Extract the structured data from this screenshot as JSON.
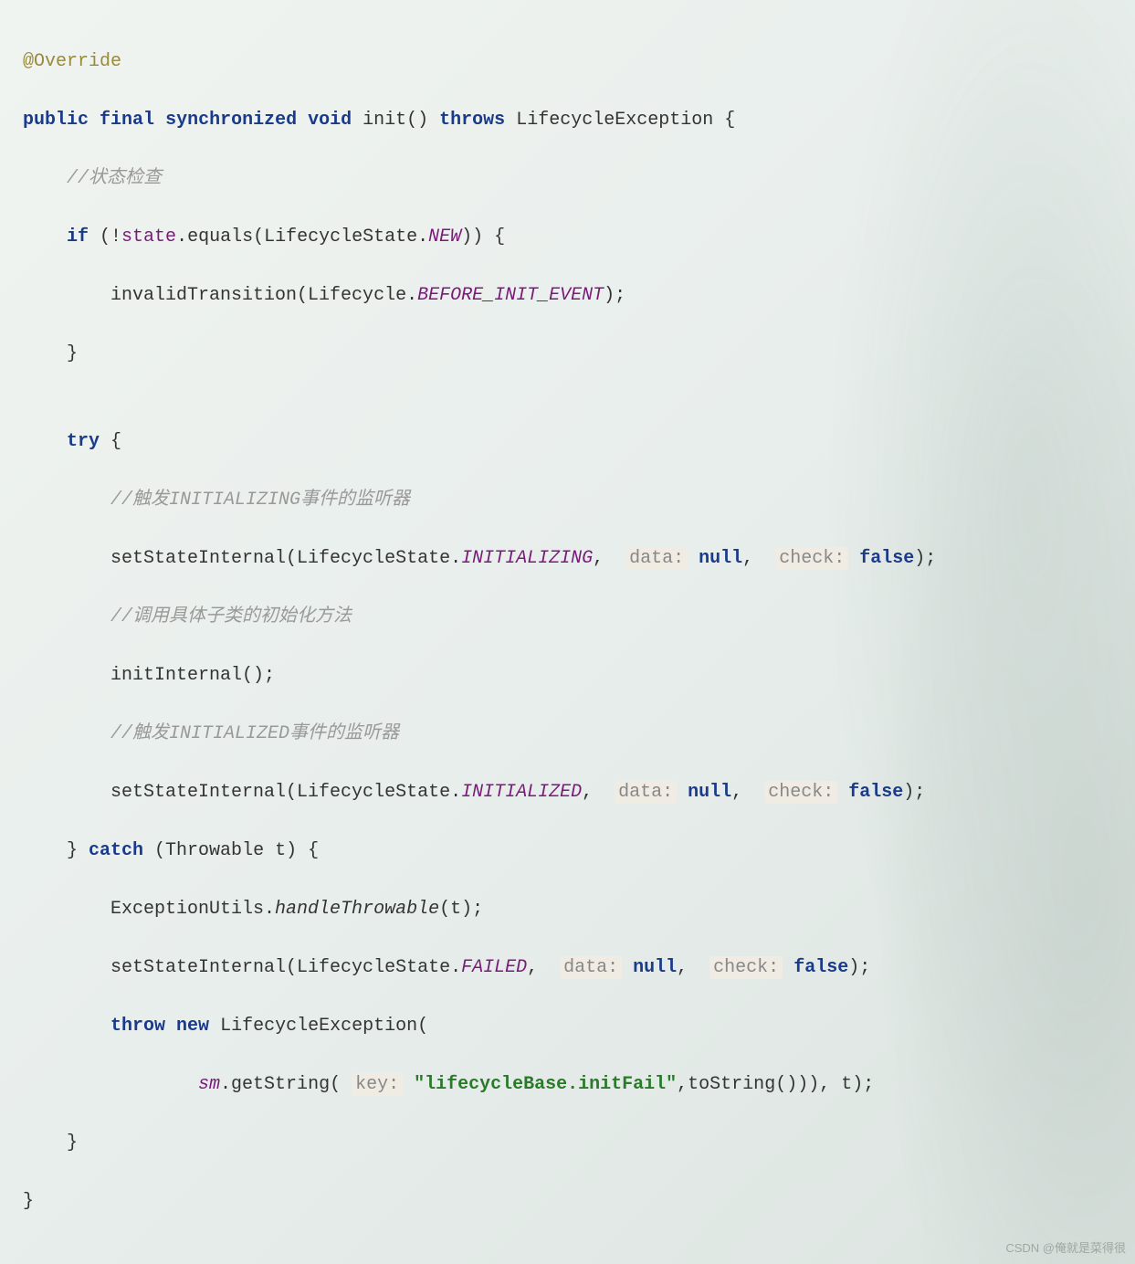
{
  "code": {
    "annotation": "@Override",
    "sig_public": "public",
    "sig_final": "final",
    "sig_sync": "synchronized",
    "sig_void": "void",
    "sig_method": "init",
    "sig_throws": "throws",
    "sig_exc": "LifecycleException",
    "comment1": "//状态检查",
    "if_kw": "if",
    "state_field": "state",
    "equals_call": ".equals(LifecycleState.",
    "new_const": "NEW",
    "invalid_call": "invalidTransition(Lifecycle.",
    "before_init": "BEFORE_INIT_EVENT",
    "try_kw": "try",
    "comment2": "//触发INITIALIZING事件的监听器",
    "set_state1": "setStateInternal(LifecycleState.",
    "initializing": "INITIALIZING",
    "hint_data": "data:",
    "null_kw": "null",
    "hint_check": "check:",
    "false_kw": "false",
    "comment3": "//调用具体子类的初始化方法",
    "init_internal": "initInternal();",
    "comment4": "//触发INITIALIZED事件的监听器",
    "initialized": "INITIALIZED",
    "catch_kw": "catch",
    "throwable": "(Throwable t) {",
    "exc_utils": "ExceptionUtils.",
    "handle_throwable": "handleThrowable",
    "failed": "FAILED",
    "throw_kw": "throw",
    "new_kw": "new",
    "lifecycle_exc": "LifecycleException(",
    "sm_field": "sm",
    "get_string": ".getString(",
    "hint_key": "key:",
    "string_lit": "\"lifecycleBase.initFail\"",
    "tostring": ",toString())), t);"
  },
  "watermark": "CSDN @俺就是菜得很"
}
